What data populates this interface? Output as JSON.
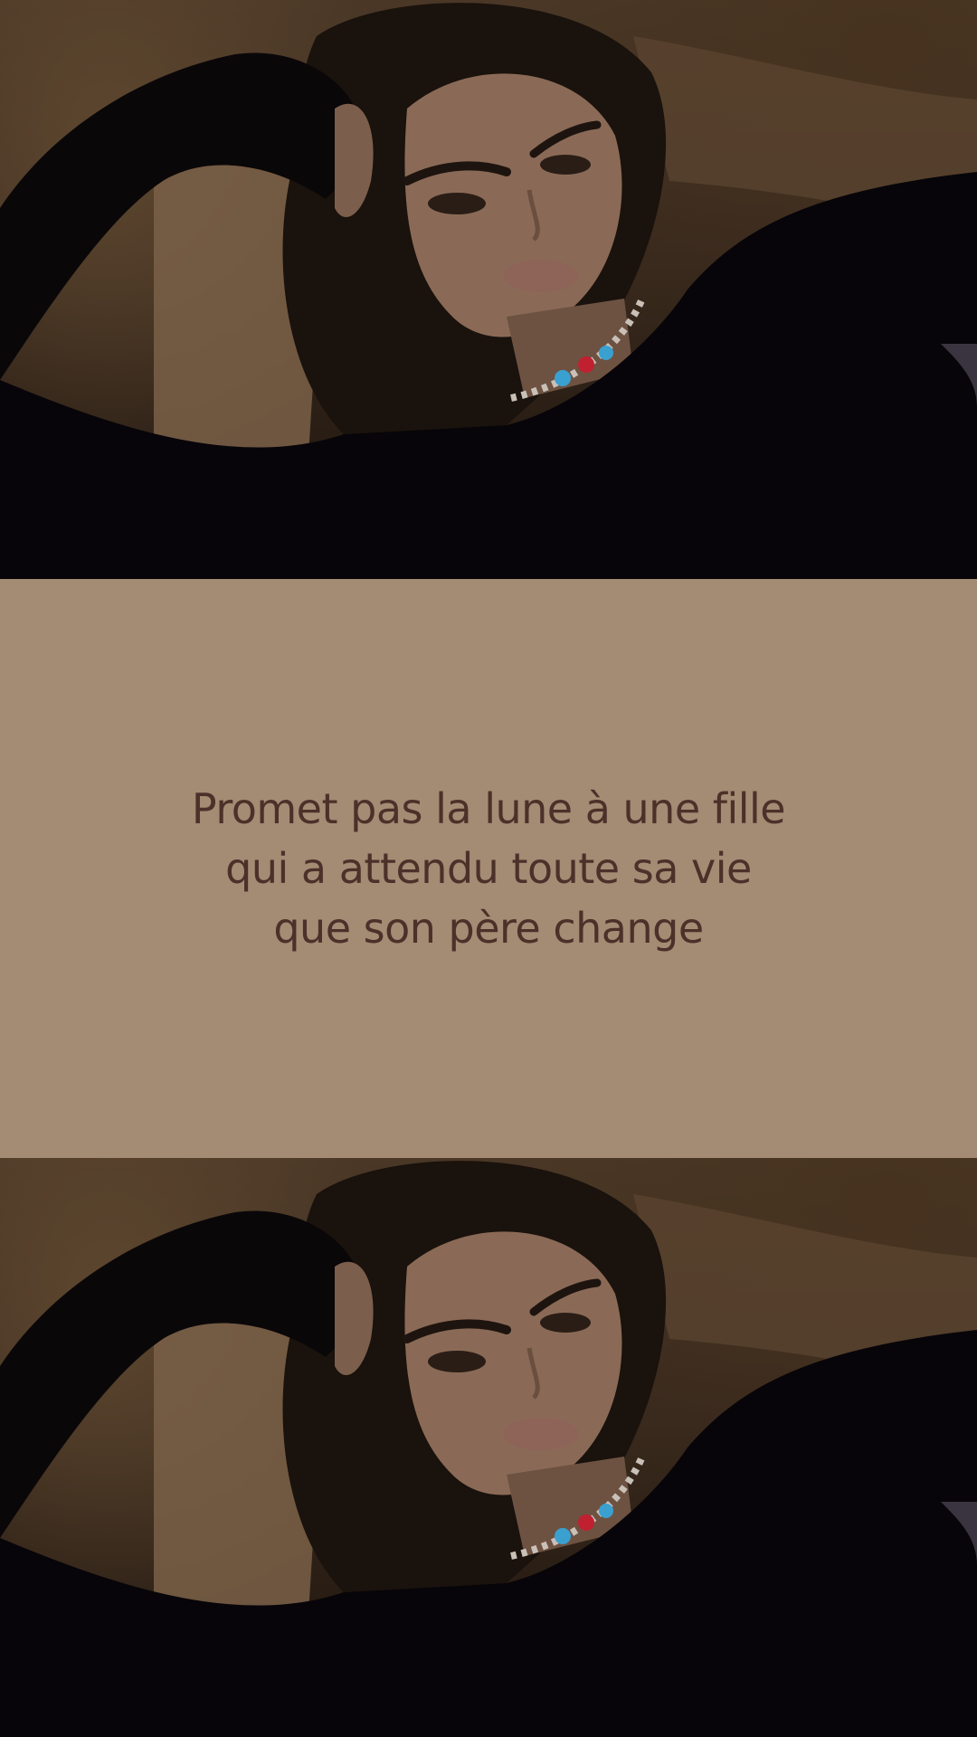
{
  "quote": {
    "lines": [
      "Promet pas la lune à une fille",
      "qui a attendu toute sa vie",
      "que son père change"
    ]
  },
  "colors": {
    "band_background": "#a48b74",
    "quote_text": "#4a3129",
    "sweater": "#070509",
    "background_wall": "#4a3726"
  },
  "photo": {
    "subject": "woman-portrait",
    "repeated": 2
  }
}
